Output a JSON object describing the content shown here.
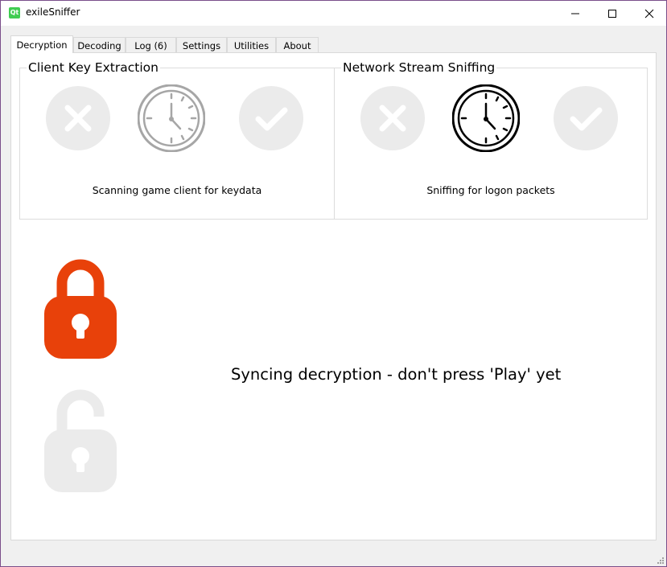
{
  "window": {
    "app_icon": "Qt",
    "title": "exileSniffer",
    "controls": [
      "minimize-icon",
      "maximize-icon",
      "close-icon"
    ]
  },
  "tabs": [
    {
      "label": "Decryption",
      "active": true
    },
    {
      "label": "Decoding",
      "active": false
    },
    {
      "label": "Log (6)",
      "active": false
    },
    {
      "label": "Settings",
      "active": false
    },
    {
      "label": "Utilities",
      "active": false
    },
    {
      "label": "About",
      "active": false
    }
  ],
  "key_extraction": {
    "title": "Client Key Extraction",
    "status": "Scanning game client for keydata",
    "state": "in-progress"
  },
  "stream_sniffing": {
    "title": "Network Stream Sniffing",
    "status": "Sniffing for logon packets",
    "state": "in-progress"
  },
  "decryption_status": {
    "message": "Syncing decryption - don't press 'Play' yet",
    "locked_icon": "locked-padlock-icon",
    "unlocked_icon": "unlocked-padlock-icon"
  },
  "colors": {
    "lock_active": "#e8410a",
    "inactive_icon": "#ebebeb",
    "clock_dim": "#a6a6a6",
    "clock_active": "#000000"
  }
}
